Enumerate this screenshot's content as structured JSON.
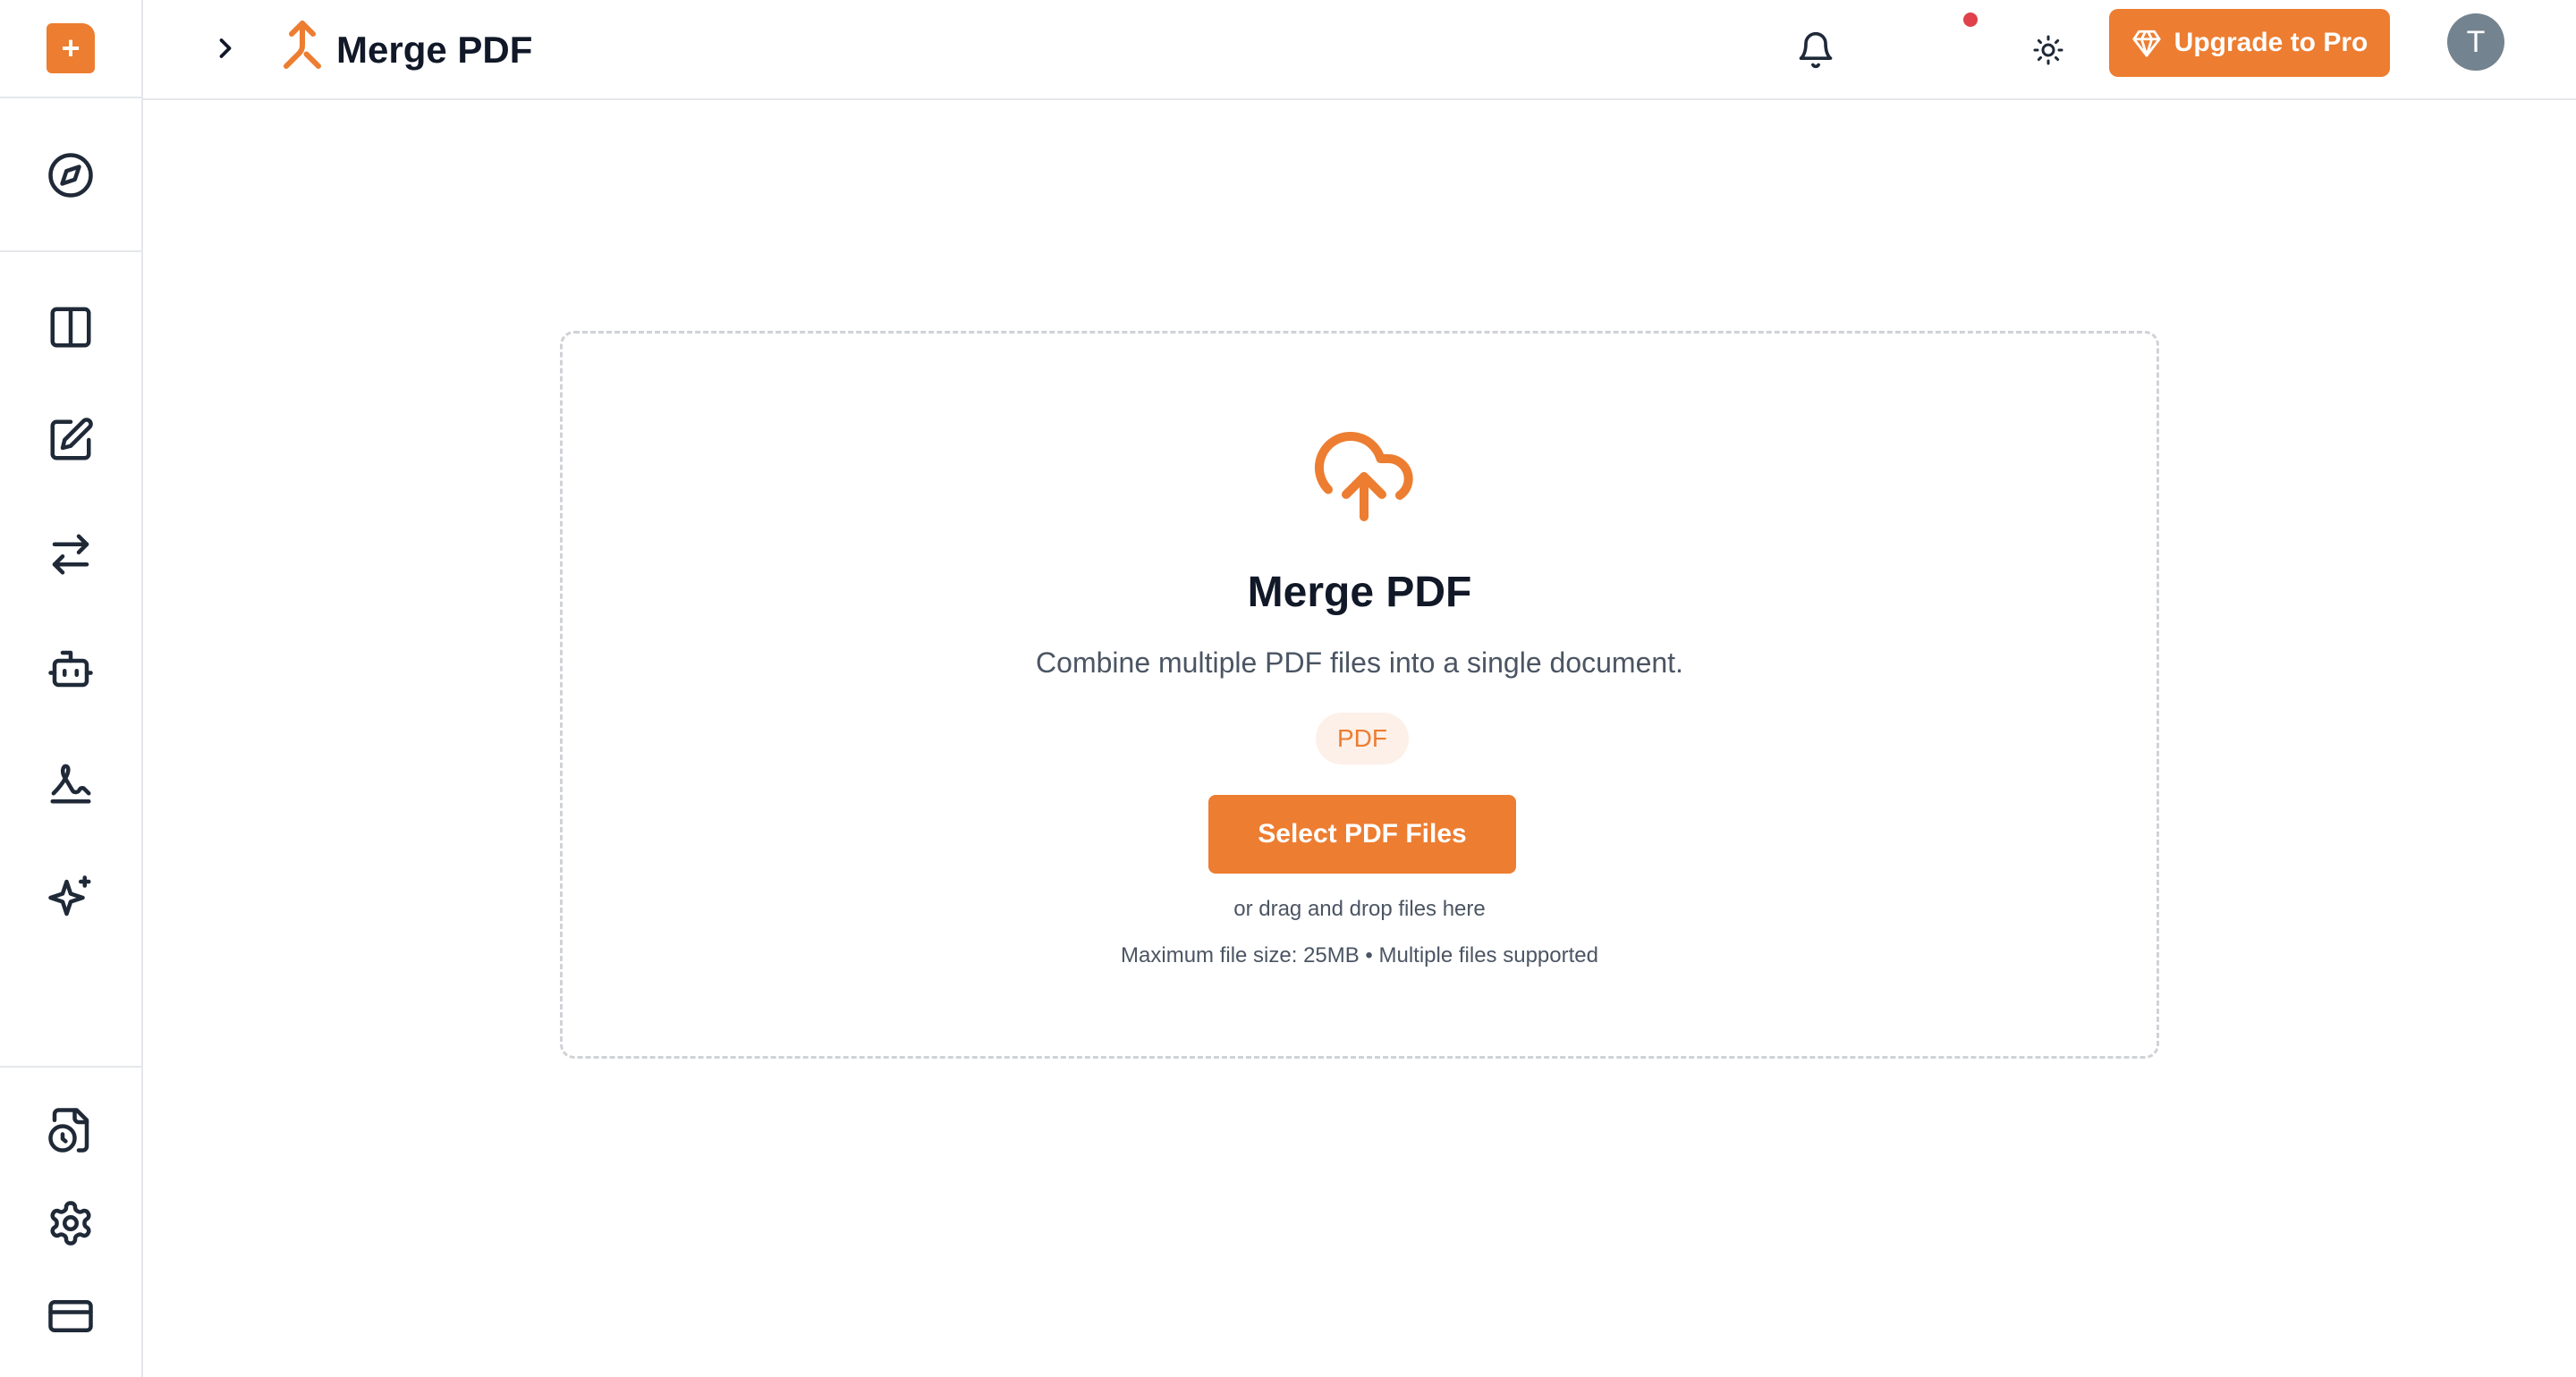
{
  "sidebar": {
    "logo_glyph": "+",
    "top_items": [
      {
        "name": "explore",
        "icon": "compass-icon"
      }
    ],
    "tool_items": [
      {
        "name": "organize",
        "icon": "columns-icon"
      },
      {
        "name": "edit",
        "icon": "edit-icon"
      },
      {
        "name": "convert",
        "icon": "arrows-swap-icon"
      },
      {
        "name": "ai-assistant",
        "icon": "robot-icon"
      },
      {
        "name": "sign",
        "icon": "signature-icon"
      },
      {
        "name": "ai-tools",
        "icon": "sparkles-icon"
      }
    ],
    "bottom_items": [
      {
        "name": "history",
        "icon": "file-clock-icon"
      },
      {
        "name": "settings",
        "icon": "gear-icon"
      },
      {
        "name": "billing",
        "icon": "credit-card-icon"
      }
    ]
  },
  "header": {
    "title": "Merge PDF",
    "title_icon": "merge-icon",
    "has_notification": true,
    "upgrade_label": "Upgrade to Pro",
    "avatar_initial": "T"
  },
  "dropzone": {
    "icon": "cloud-upload-icon",
    "title": "Merge PDF",
    "description": "Combine multiple PDF files into a single document.",
    "badge": "PDF",
    "button_label": "Select PDF Files",
    "drag_text": "or drag and drop files here",
    "limit_text": "Maximum file size: 25MB • Multiple files supported"
  },
  "colors": {
    "accent": "#ed7d31",
    "badge_bg": "#fdf0e8",
    "notification_dot": "#e0414a",
    "avatar_bg": "#738390"
  }
}
